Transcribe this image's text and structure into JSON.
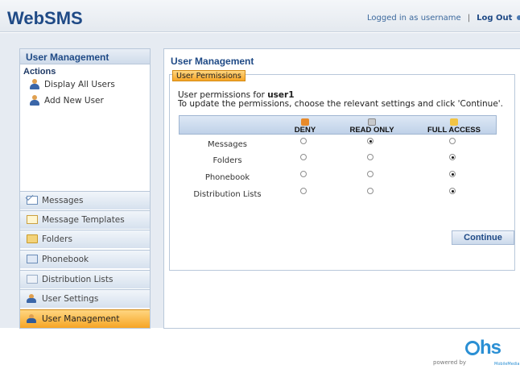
{
  "app": {
    "title": "WebSMS"
  },
  "header": {
    "logged_in_text": "Logged in as username",
    "separator": "|",
    "logout_label": "Log Out"
  },
  "sidebar": {
    "title": "User Management",
    "actions_title": "Actions",
    "actions": [
      {
        "label": "Display All Users",
        "icon": "user-icon"
      },
      {
        "label": "Add New User",
        "icon": "user-icon"
      }
    ],
    "nav": [
      {
        "label": "Messages",
        "icon": "mail-icon"
      },
      {
        "label": "Message Templates",
        "icon": "template-icon"
      },
      {
        "label": "Folders",
        "icon": "folder-icon"
      },
      {
        "label": "Phonebook",
        "icon": "phonebook-icon"
      },
      {
        "label": "Distribution Lists",
        "icon": "list-icon"
      },
      {
        "label": "User Settings",
        "icon": "user-settings-icon"
      },
      {
        "label": "User Management",
        "icon": "user-management-icon",
        "active": true
      }
    ]
  },
  "main": {
    "title": "User Management",
    "legend": "User Permissions",
    "intro_prefix": "User permissions for",
    "username": "user1",
    "intro_line2": "To update the permissions, choose the relevant settings and click 'Continue'.",
    "columns": [
      "DENY",
      "READ ONLY",
      "FULL ACCESS"
    ],
    "rows": [
      {
        "name": "Messages",
        "selected": "READ ONLY"
      },
      {
        "name": "Folders",
        "selected": "FULL ACCESS"
      },
      {
        "name": "Phonebook",
        "selected": "FULL ACCESS"
      },
      {
        "name": "Distribution Lists",
        "selected": "FULL ACCESS"
      }
    ],
    "continue_label": "Continue"
  },
  "footer": {
    "powered_by": "powered by",
    "brand": "hs",
    "brand_sub": "MobileMedia"
  },
  "colors": {
    "brand": "#1f4a86",
    "accent": "#f6a526",
    "panel_border": "#b9c8da",
    "logo_blue": "#2a8fd4"
  }
}
